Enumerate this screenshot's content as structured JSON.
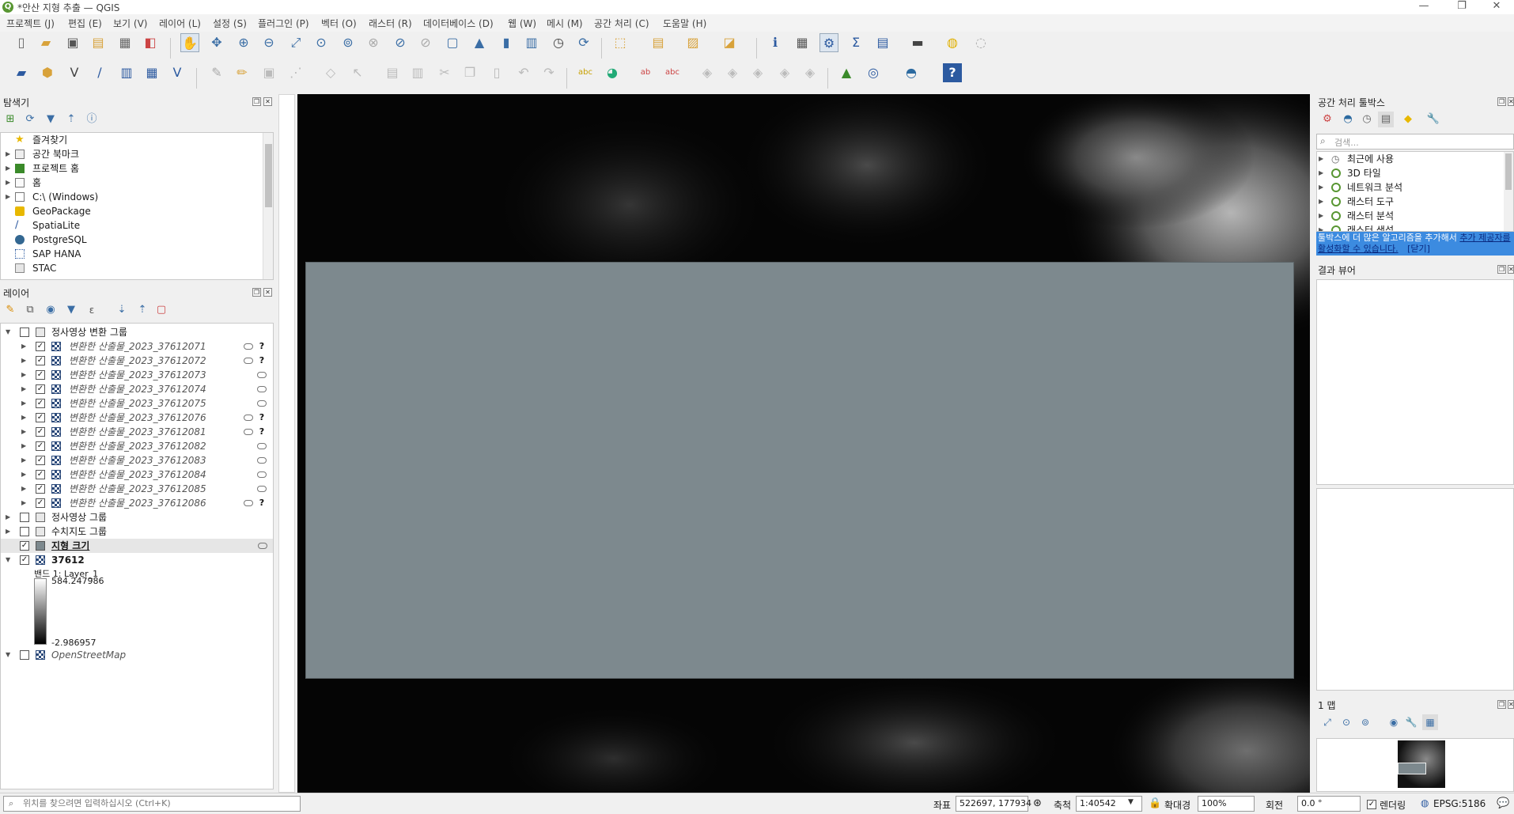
{
  "window": {
    "title": "*안산 지형 추출 — QGIS",
    "logo_letter": "Q"
  },
  "menu": [
    "프로젝트 (J)",
    "편집 (E)",
    "보기 (V)",
    "레이어 (L)",
    "설정 (S)",
    "플러그인 (P)",
    "벡터 (O)",
    "래스터 (R)",
    "데이터베이스 (D)",
    "웹 (W)",
    "메시 (M)",
    "공간 처리 (C)",
    "도움말 (H)"
  ],
  "browser": {
    "title": "탐색기",
    "items": [
      {
        "label": "즐겨찾기",
        "icon": "star-icon"
      },
      {
        "label": "공간 북마크",
        "icon": "bookmark-icon"
      },
      {
        "label": "프로젝트 홈",
        "icon": "project-home-icon"
      },
      {
        "label": "홈",
        "icon": "home-folder-icon"
      },
      {
        "label": "C:\\ (Windows)",
        "icon": "drive-icon"
      },
      {
        "label": "GeoPackage",
        "icon": "geopackage-icon"
      },
      {
        "label": "SpatiaLite",
        "icon": "spatialite-icon"
      },
      {
        "label": "PostgreSQL",
        "icon": "postgresql-icon"
      },
      {
        "label": "SAP HANA",
        "icon": "sap-hana-icon"
      },
      {
        "label": "STAC",
        "icon": "stac-icon"
      }
    ]
  },
  "layers": {
    "title": "레이어",
    "group1": "정사영상 변환 그룹",
    "sublayers": [
      "변환한 산출물_2023_37612071",
      "변환한 산출물_2023_37612072",
      "변환한 산출물_2023_37612073",
      "변환한 산출물_2023_37612074",
      "변환한 산출물_2023_37612075",
      "변환한 산출물_2023_37612076",
      "변환한 산출물_2023_37612081",
      "변환한 산출물_2023_37612082",
      "변환한 산출물_2023_37612083",
      "변환한 산출물_2023_37612084",
      "변환한 산출물_2023_37612085",
      "변환한 산출물_2023_37612086"
    ],
    "group2": "정사영상 그룹",
    "group3": "수치지도 그룹",
    "terrain_layer": "지형 크기",
    "dem_layer": "37612",
    "band_label": "밴드 1: Layer_1",
    "band_max": "584.247986",
    "band_min": "-2.986957",
    "osm_layer": "OpenStreetMap"
  },
  "processing": {
    "title": "공간 처리 툴박스",
    "search_placeholder": "검색...",
    "items": [
      "최근에 사용",
      "3D 타일",
      "네트워크 분석",
      "래스터 도구",
      "래스터 분석",
      "래스터 생성"
    ],
    "banner_text": "툴박스에 더 많은 알고리즘을 추가해서",
    "banner_link1": "추가 제공자를 활성화할 수 있습니다.",
    "banner_close": "[닫기]"
  },
  "results": {
    "title": "결과 뷰어"
  },
  "overview": {
    "title": "1 맵"
  },
  "status": {
    "locator_placeholder": "위치를 찾으려면 입력하십시오 (Ctrl+K)",
    "coord_label": "좌표",
    "coord_value": "522697, 177934",
    "scale_label": "축척",
    "scale_value": "1:40542",
    "mag_label": "확대경",
    "mag_value": "100%",
    "rotation_label": "회전",
    "rotation_value": "0.0 °",
    "render_label": "렌더링",
    "crs": "EPSG:5186"
  },
  "colors": {
    "map_overlay": "#7d898e",
    "banner_bg": "#3c8be0",
    "qgis_green": "#589632"
  }
}
